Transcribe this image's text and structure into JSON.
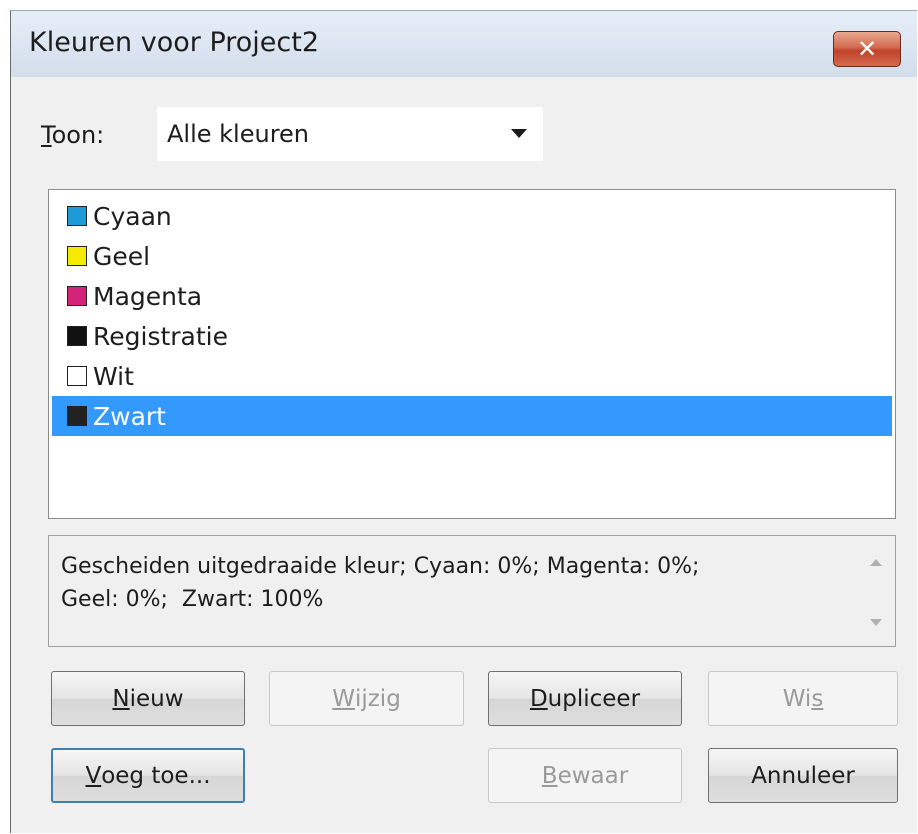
{
  "window": {
    "title": "Kleuren voor Project2",
    "close_glyph": "✕"
  },
  "toon": {
    "label_key": "T",
    "label_rest": "oon:",
    "selected": "Alle kleuren",
    "arrow_icon": "dropdown-arrow-icon"
  },
  "colors": {
    "items": [
      {
        "label": "Cyaan",
        "swatch": "#1e9ad6",
        "selected": false
      },
      {
        "label": "Geel",
        "swatch": "#f4ea00",
        "selected": false
      },
      {
        "label": "Magenta",
        "swatch": "#d6237a",
        "selected": false
      },
      {
        "label": "Registratie",
        "swatch": "#111111",
        "selected": false
      },
      {
        "label": "Wit",
        "swatch": "#ffffff",
        "selected": false
      },
      {
        "label": "Zwart",
        "swatch": "#222222",
        "selected": true
      }
    ]
  },
  "info": {
    "line1": "Gescheiden uitgedraaide kleur; Cyaan: 0%; Magenta: 0%;",
    "line2": "Geel: 0%;  Zwart: 100%"
  },
  "buttons": {
    "nieuw": {
      "key": "N",
      "rest": "ieuw",
      "enabled": true
    },
    "wijzig": {
      "key": "W",
      "rest": "ijzig",
      "enabled": false
    },
    "dupliceer": {
      "key": "D",
      "rest": "upliceer",
      "enabled": true
    },
    "wis": {
      "pre": "Wi",
      "key": "s",
      "enabled": false
    },
    "voeg_toe": {
      "key": "V",
      "rest": "oeg toe...",
      "enabled": true
    },
    "bewaar": {
      "key": "B",
      "rest": "ewaar",
      "enabled": false
    },
    "annuleer": {
      "label": "Annuleer",
      "enabled": true
    }
  },
  "colors_ui": {
    "selection": "#3399ff",
    "dialog_bg": "#f0f0f0",
    "close_button": "#c0432a"
  }
}
